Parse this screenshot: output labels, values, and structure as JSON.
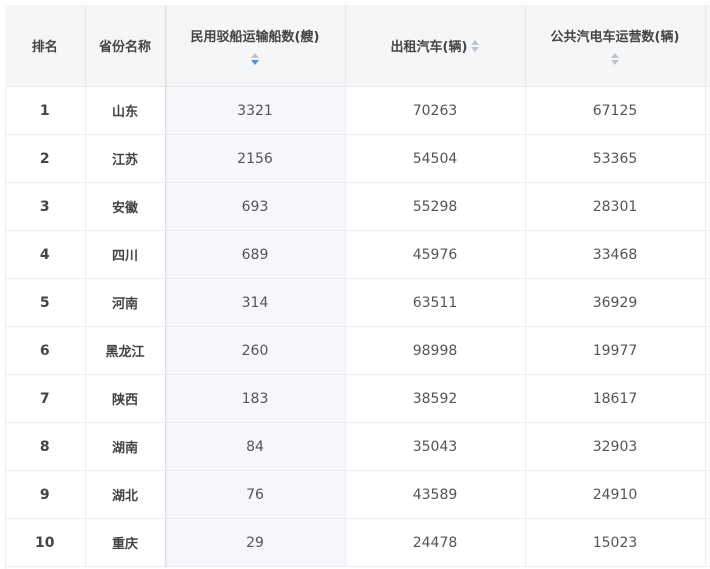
{
  "table": {
    "headers": {
      "rank": "排名",
      "province": "省份名称",
      "boats": "民用驳船运输船数(艘)",
      "taxis": "出租汽车(辆)",
      "buses": "公共汽电车运营数(辆)"
    },
    "sort": {
      "column": "boats",
      "direction": "descending"
    },
    "rows": [
      {
        "rank": "1",
        "province": "山东",
        "boats": "3321",
        "taxis": "70263",
        "buses": "67125"
      },
      {
        "rank": "2",
        "province": "江苏",
        "boats": "2156",
        "taxis": "54504",
        "buses": "53365"
      },
      {
        "rank": "3",
        "province": "安徽",
        "boats": "693",
        "taxis": "55298",
        "buses": "28301"
      },
      {
        "rank": "4",
        "province": "四川",
        "boats": "689",
        "taxis": "45976",
        "buses": "33468"
      },
      {
        "rank": "5",
        "province": "河南",
        "boats": "314",
        "taxis": "63511",
        "buses": "36929"
      },
      {
        "rank": "6",
        "province": "黑龙江",
        "boats": "260",
        "taxis": "98998",
        "buses": "19977"
      },
      {
        "rank": "7",
        "province": "陕西",
        "boats": "183",
        "taxis": "38592",
        "buses": "18617"
      },
      {
        "rank": "8",
        "province": "湖南",
        "boats": "84",
        "taxis": "35043",
        "buses": "32903"
      },
      {
        "rank": "9",
        "province": "湖北",
        "boats": "76",
        "taxis": "43589",
        "buses": "24910"
      },
      {
        "rank": "10",
        "province": "重庆",
        "boats": "29",
        "taxis": "24478",
        "buses": "15023"
      }
    ]
  },
  "colors": {
    "header_bg": "#f5f6f7",
    "sorted_col_bg": "#f5f7fb",
    "sort_active": "#4a90e2",
    "sort_inactive": "#c0c4c8"
  }
}
